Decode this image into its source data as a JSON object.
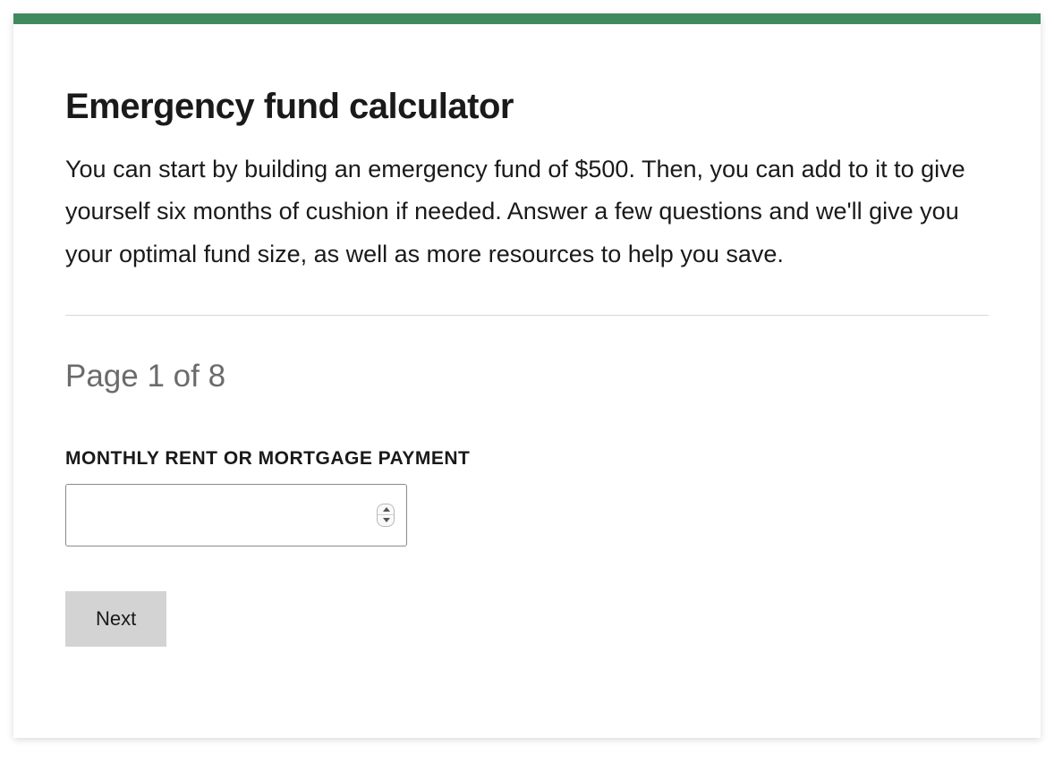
{
  "header": {
    "title": "Emergency fund calculator",
    "description": "You can start by building an emergency fund of $500. Then, you can add to it to give yourself six months of cushion if needed. Answer a few questions and we'll give you your optimal fund size, as well as more resources to help you save."
  },
  "pagination": {
    "text": "Page 1 of 8",
    "current": 1,
    "total": 8
  },
  "form": {
    "field_label": "MONTHLY RENT OR MORTGAGE PAYMENT",
    "field_value": ""
  },
  "buttons": {
    "next": "Next"
  },
  "colors": {
    "accent": "#3f8a5f",
    "button_bg": "#d3d3d3"
  }
}
